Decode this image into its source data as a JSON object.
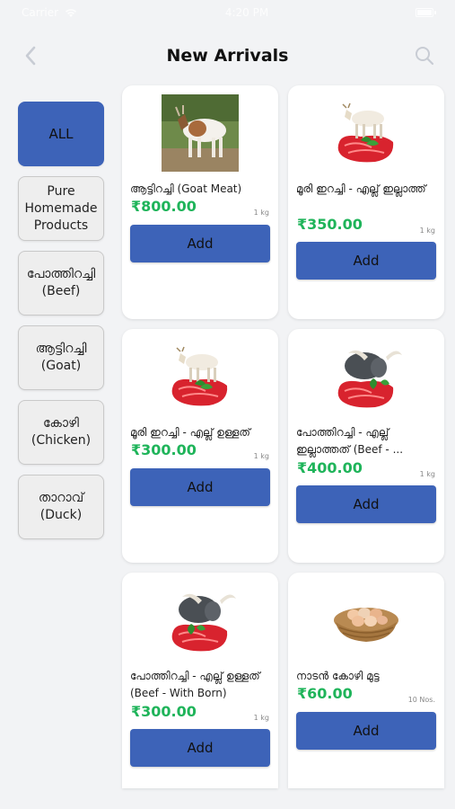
{
  "status_bar": {
    "carrier": "Carrier",
    "time": "4:20 PM"
  },
  "header": {
    "title": "New Arrivals",
    "back_icon": "chevron-left-icon",
    "search_icon": "search-icon"
  },
  "categories": [
    {
      "label": "ALL",
      "active": true
    },
    {
      "label": "Pure\nHomemade\nProducts",
      "active": false
    },
    {
      "label": "പോത്തിറച്ചി\n(Beef)",
      "active": false
    },
    {
      "label": "ആട്ടിറച്ചി\n(Goat)",
      "active": false
    },
    {
      "label": "കോഴി\n(Chicken)",
      "active": false
    },
    {
      "label": "താറാവ്\n(Duck)",
      "active": false
    }
  ],
  "products": [
    {
      "name": "ആട്ടിറച്ചി (Goat Meat)",
      "price": "₹800.00",
      "unit": "1 kg",
      "add_label": "Add",
      "image": "goat-photo"
    },
    {
      "name": "മൂരി ഇറച്ചി - എല്ല് ഇല്ലാത്ത്",
      "price": "₹350.00",
      "unit": "1 kg",
      "add_label": "Add",
      "image": "cow-meat-icon"
    },
    {
      "name": "മൂരി ഇറച്ചി - എല്ല് ഉള്ളത്",
      "price": "₹300.00",
      "unit": "1 kg",
      "add_label": "Add",
      "image": "cow-meat-icon"
    },
    {
      "name": "പോത്തിറച്ചി - എല്ല് ഇല്ലാത്തത് (Beef - ...",
      "price": "₹400.00",
      "unit": "1 kg",
      "add_label": "Add",
      "image": "buffalo-meat-icon"
    },
    {
      "name": "പോത്തിറച്ചി - എല്ല് ഉള്ളത് (Beef - With Born)",
      "price": "₹300.00",
      "unit": "1 kg",
      "add_label": "Add",
      "image": "buffalo-meat-icon"
    },
    {
      "name": "നാടൻ കോഴി മുട്ട",
      "price": "₹60.00",
      "unit": "10 Nos.",
      "add_label": "Add",
      "image": "eggs-basket-icon"
    }
  ],
  "colors": {
    "primary": "#3d63b8",
    "price": "#1fb45a",
    "background": "#f2f3f5"
  }
}
